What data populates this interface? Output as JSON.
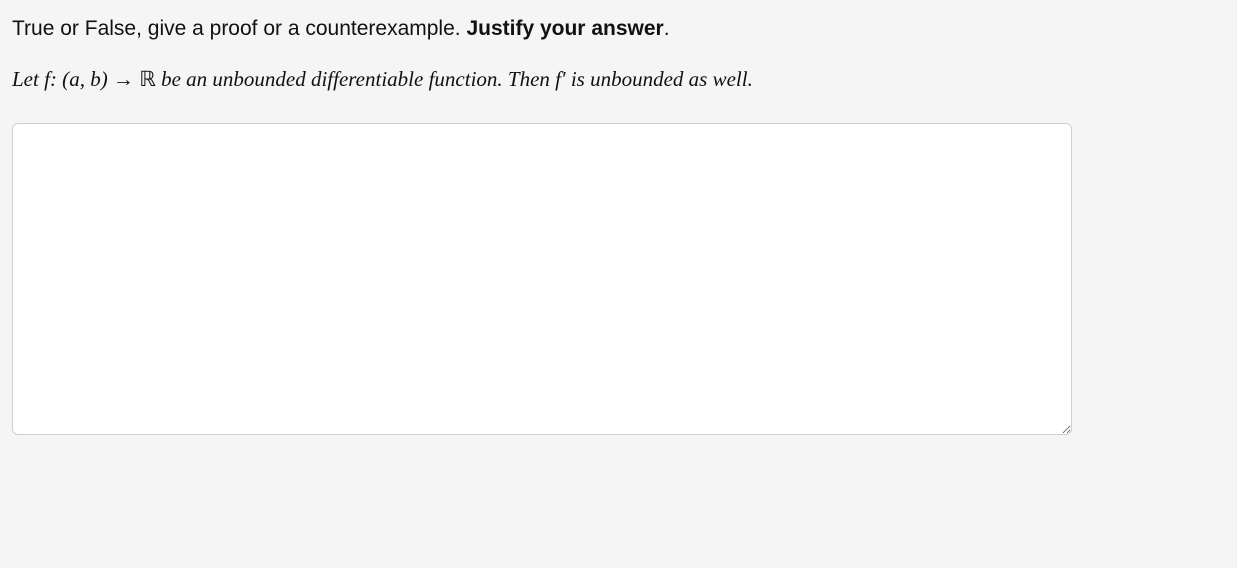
{
  "question": {
    "prompt_prefix": "True or False, give a proof or a counterexample. ",
    "prompt_bold": "Justify your answer",
    "prompt_suffix": ".",
    "statement": {
      "let": "Let ",
      "f": "f",
      "colon_open": ": (",
      "a": "a",
      "comma": ", ",
      "b": "b",
      "close_arrow": ") → ",
      "R": "ℝ",
      "mid1": " be an unbounded differentiable function. Then ",
      "f2": "f",
      "prime": "′",
      "mid2": " is unbounded as well."
    }
  },
  "answer": {
    "value": "",
    "placeholder": ""
  }
}
